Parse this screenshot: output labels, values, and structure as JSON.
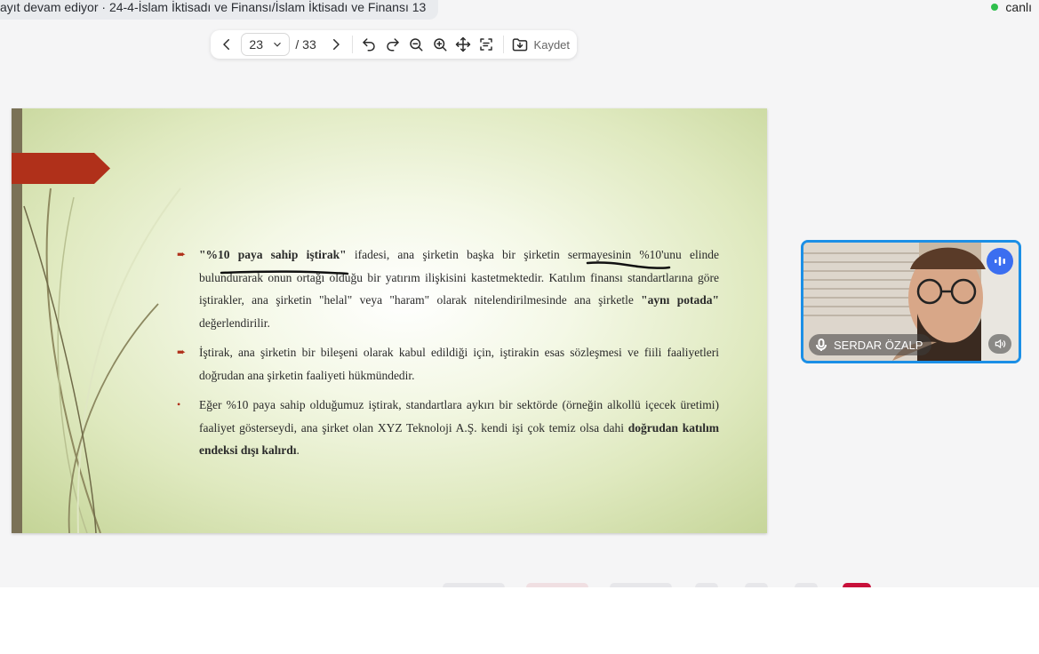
{
  "recording_banner": "ayıt devam ediyor · 24-4-İslam İktisadı ve Finansı/İslam İktisadı ve Finansı 13",
  "live_label": "canlı",
  "toolbar": {
    "current_page": "23",
    "total_pages": "/ 33",
    "save_label": "Kaydet",
    "icons": [
      "chevron-left-icon",
      "chevron-down-icon",
      "chevron-right-icon",
      "undo-icon",
      "redo-icon",
      "zoom-out-icon",
      "zoom-in-icon",
      "move-icon",
      "fit-page-icon",
      "save-icon"
    ]
  },
  "slide": {
    "bullets": [
      {
        "marker": "➨",
        "parts": [
          {
            "text": "\"%10 paya sahip iştirak\"",
            "bold": true
          },
          {
            "text": " ifadesi, ana şirketin başka bir şirketin sermayesinin %10'unu elinde bulundurarak onun ortağı olduğu bir yatırım ilişkisini kastetmektedir. Katılım finansı standartlarına göre iştirakler, ana şirketin \"helal\" veya \"haram\" olarak nitelendirilmesinde ana şirketle ",
            "bold": false
          },
          {
            "text": "\"aynı potada\"",
            "bold": true
          },
          {
            "text": " değerlendirilir.",
            "bold": false
          }
        ]
      },
      {
        "marker": "➨",
        "parts": [
          {
            "text": "İştirak, ana şirketin bir bileşeni olarak kabul edildiği için, iştirakin esas sözleşmesi ve fiili faaliyetleri doğrudan ana şirketin faaliyeti hükmündedir.",
            "bold": false
          }
        ]
      },
      {
        "marker": "•",
        "parts": [
          {
            "text": "Eğer %10 paya sahip olduğumuz iştirak, standartlara aykırı bir sektörde (örneğin alkollü içecek üretimi) faaliyet gösterseydi, ana şirket olan XYZ Teknoloji A.Ş. kendi işi çok temiz olsa dahi ",
            "bold": false
          },
          {
            "text": "doğrudan katılım endeksi dışı kalırdı",
            "bold": true
          },
          {
            "text": ".",
            "bold": false
          }
        ]
      }
    ]
  },
  "video": {
    "participant_name": "SERDAR ÖZALP",
    "speaking": true
  },
  "colors": {
    "accent_blue": "#1b8fe6",
    "slide_arrow": "#b0301a",
    "live_dot": "#2fbf4c"
  }
}
